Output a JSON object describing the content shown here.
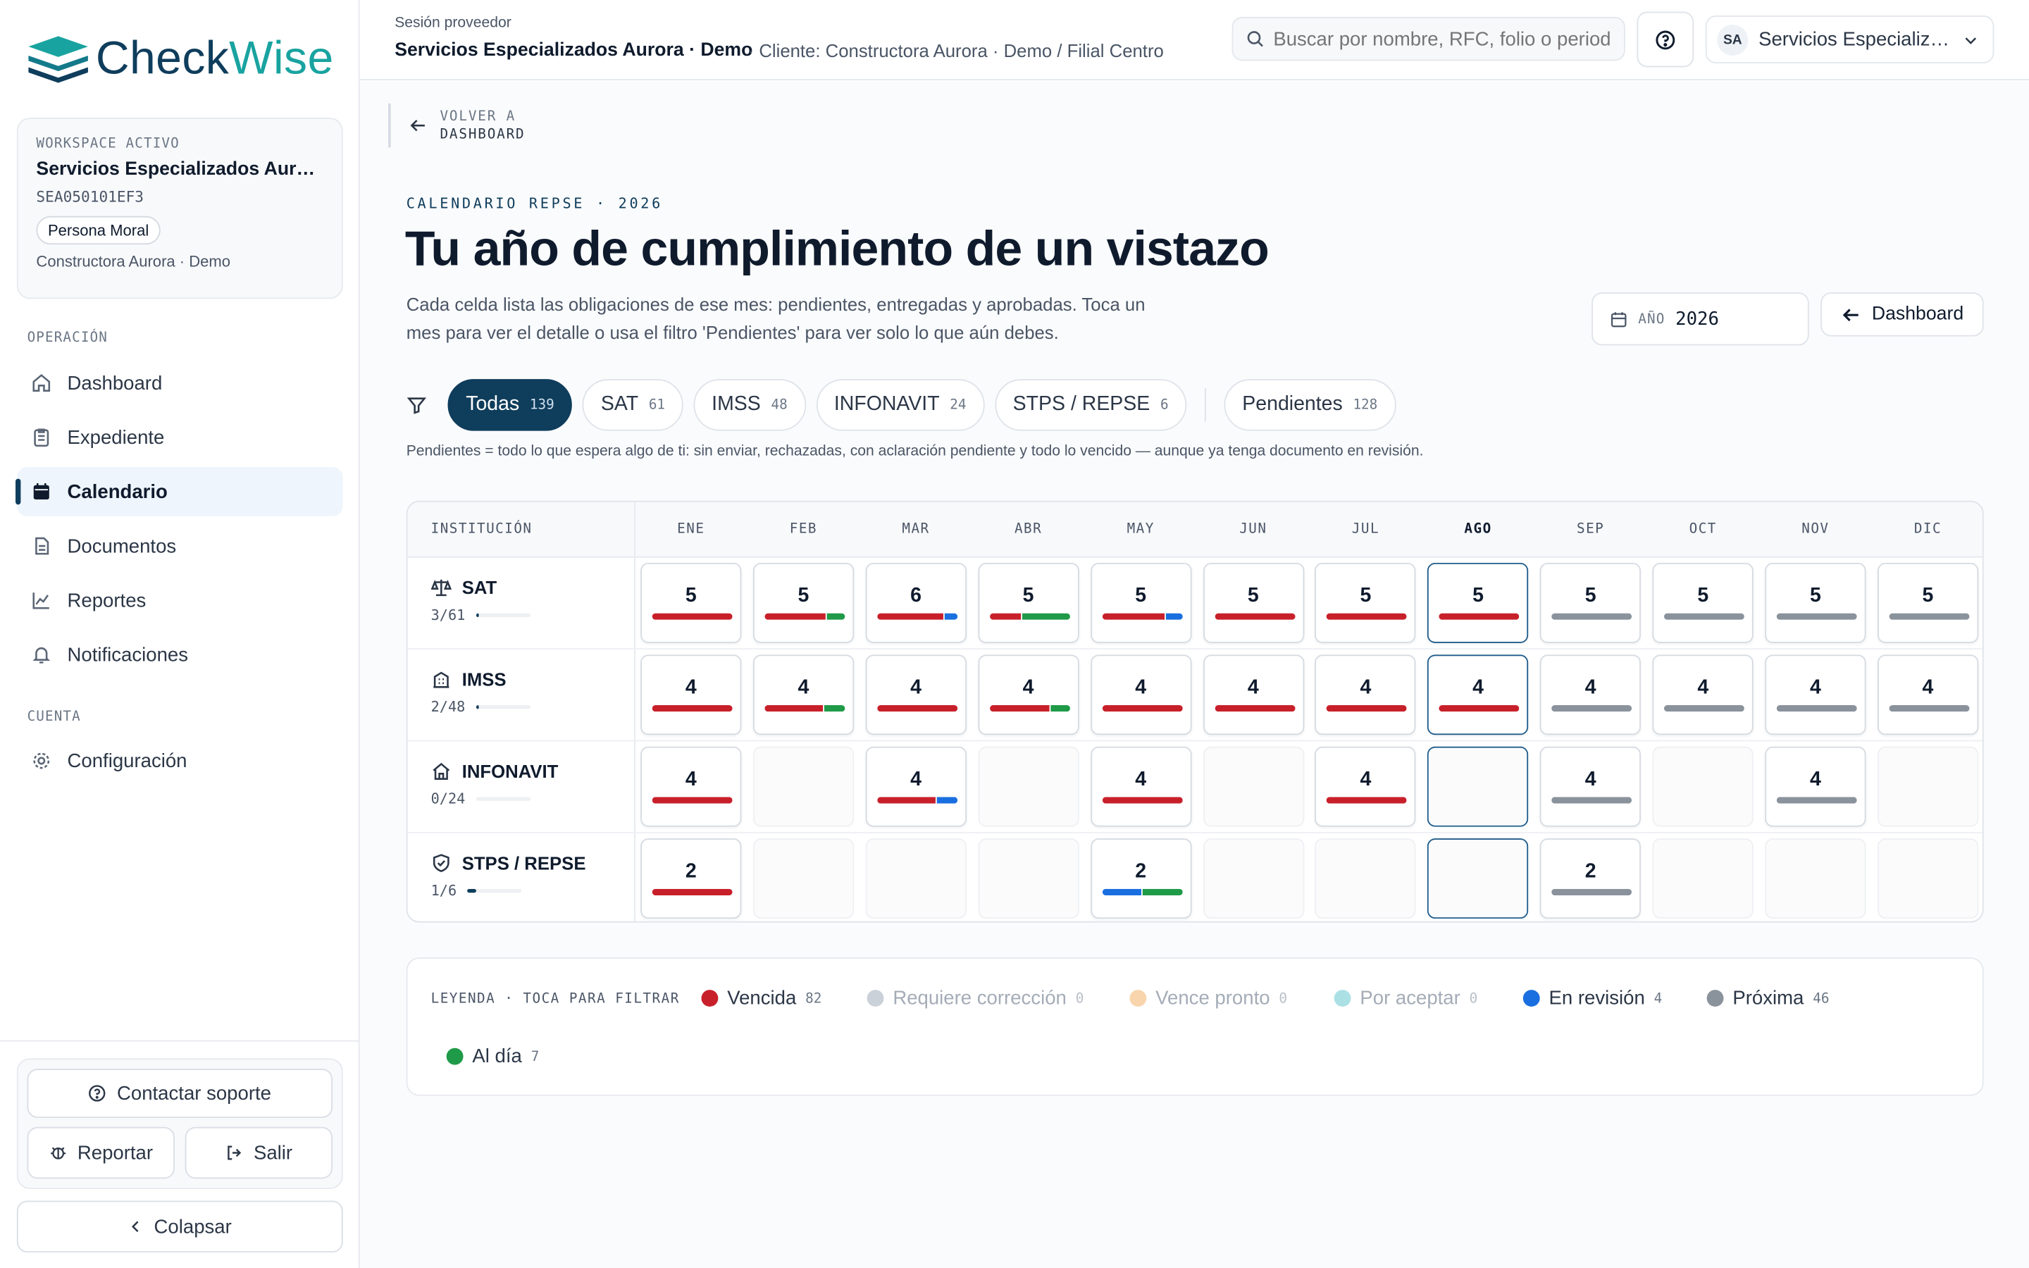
{
  "brand": {
    "name_part1": "Check",
    "name_part2": "Wise"
  },
  "workspace": {
    "label": "WORKSPACE ACTIVO",
    "name": "Servicios Especializados Aurora · Demo",
    "rfc": "SEA050101EF3",
    "type": "Persona Moral",
    "client": "Constructora Aurora · Demo"
  },
  "nav": {
    "section_operacion": "OPERACIÓN",
    "section_cuenta": "CUENTA",
    "items": [
      {
        "label": "Dashboard",
        "icon": "home-icon"
      },
      {
        "label": "Expediente",
        "icon": "clipboard-icon"
      },
      {
        "label": "Calendario",
        "icon": "calendar-icon",
        "active": true
      },
      {
        "label": "Documentos",
        "icon": "documents-icon"
      },
      {
        "label": "Reportes",
        "icon": "chart-icon"
      },
      {
        "label": "Notificaciones",
        "icon": "bell-icon"
      }
    ],
    "config_label": "Configuración"
  },
  "sidebar_footer": {
    "support": "Contactar soporte",
    "report": "Reportar",
    "logout": "Salir",
    "collapse": "Colapsar"
  },
  "topbar": {
    "session_label": "Sesión proveedor",
    "provider": "Servicios Especializados Aurora · Demo",
    "client_path": "· Cliente: Constructora Aurora · Demo / Filial Centro",
    "search_placeholder": "Buscar por nombre, RFC, folio o periodo",
    "account_initials": "SA",
    "account_name": "Servicios Especializados Aurora · Demo"
  },
  "back": {
    "line1": "VOLVER A",
    "line2": "DASHBOARD"
  },
  "header": {
    "eyebrow": "CALENDARIO REPSE · 2026",
    "title": "Tu año de cumplimiento de un vistazo",
    "description": "Cada celda lista las obligaciones de ese mes: pendientes, entregadas y aprobadas. Toca un mes para ver el detalle o usa el filtro 'Pendientes' para ver solo lo que aún debes.",
    "year_label": "AÑO",
    "year_value": "2026",
    "dashboard_button": "Dashboard"
  },
  "filters": [
    {
      "label": "Todas",
      "count": "139",
      "active": true
    },
    {
      "label": "SAT",
      "count": "61"
    },
    {
      "label": "IMSS",
      "count": "48"
    },
    {
      "label": "INFONAVIT",
      "count": "24"
    },
    {
      "label": "STPS / REPSE",
      "count": "6"
    },
    {
      "label": "Pendientes",
      "count": "128",
      "separated": true
    }
  ],
  "filter_note": "Pendientes = todo lo que espera algo de ti: sin enviar, rechazadas, con aclaración pendiente y todo lo vencido — aunque ya tenga documento en revisión.",
  "calendar": {
    "institution_header": "INSTITUCIÓN",
    "months": [
      "ENE",
      "FEB",
      "MAR",
      "ABR",
      "MAY",
      "JUN",
      "JUL",
      "AGO",
      "SEP",
      "OCT",
      "NOV",
      "DIC"
    ],
    "current_month_index": 7,
    "rows": [
      {
        "name": "SAT",
        "icon": "scale-icon",
        "progress_text": "3/61",
        "progress": 0.049,
        "cells": [
          {
            "count": "5",
            "segments": [
              [
                "red",
                1
              ]
            ]
          },
          {
            "count": "5",
            "segments": [
              [
                "red",
                0.78
              ],
              [
                "green",
                0.22
              ]
            ]
          },
          {
            "count": "6",
            "segments": [
              [
                "red",
                0.84
              ],
              [
                "blue",
                0.16
              ]
            ]
          },
          {
            "count": "5",
            "segments": [
              [
                "red",
                0.4
              ],
              [
                "green",
                0.6
              ]
            ]
          },
          {
            "count": "5",
            "segments": [
              [
                "red",
                0.8
              ],
              [
                "blue",
                0.2
              ]
            ]
          },
          {
            "count": "5",
            "segments": [
              [
                "red",
                1
              ]
            ]
          },
          {
            "count": "5",
            "segments": [
              [
                "red",
                1
              ]
            ]
          },
          {
            "count": "5",
            "segments": [
              [
                "red",
                1
              ]
            ]
          },
          {
            "count": "5",
            "segments": [
              [
                "gray",
                1
              ]
            ]
          },
          {
            "count": "5",
            "segments": [
              [
                "gray",
                1
              ]
            ]
          },
          {
            "count": "5",
            "segments": [
              [
                "gray",
                1
              ]
            ]
          },
          {
            "count": "5",
            "segments": [
              [
                "gray",
                1
              ]
            ]
          }
        ]
      },
      {
        "name": "IMSS",
        "icon": "building-icon",
        "progress_text": "2/48",
        "progress": 0.042,
        "cells": [
          {
            "count": "4",
            "segments": [
              [
                "red",
                1
              ]
            ]
          },
          {
            "count": "4",
            "segments": [
              [
                "red",
                0.74
              ],
              [
                "green",
                0.26
              ]
            ]
          },
          {
            "count": "4",
            "segments": [
              [
                "red",
                1
              ]
            ]
          },
          {
            "count": "4",
            "segments": [
              [
                "red",
                0.76
              ],
              [
                "green",
                0.24
              ]
            ]
          },
          {
            "count": "4",
            "segments": [
              [
                "red",
                1
              ]
            ]
          },
          {
            "count": "4",
            "segments": [
              [
                "red",
                1
              ]
            ]
          },
          {
            "count": "4",
            "segments": [
              [
                "red",
                1
              ]
            ]
          },
          {
            "count": "4",
            "segments": [
              [
                "red",
                1
              ]
            ]
          },
          {
            "count": "4",
            "segments": [
              [
                "gray",
                1
              ]
            ]
          },
          {
            "count": "4",
            "segments": [
              [
                "gray",
                1
              ]
            ]
          },
          {
            "count": "4",
            "segments": [
              [
                "gray",
                1
              ]
            ]
          },
          {
            "count": "4",
            "segments": [
              [
                "gray",
                1
              ]
            ]
          }
        ]
      },
      {
        "name": "INFONAVIT",
        "icon": "house-icon",
        "progress_text": "0/24",
        "progress": 0,
        "cells": [
          {
            "count": "4",
            "segments": [
              [
                "red",
                1
              ]
            ]
          },
          null,
          {
            "count": "4",
            "segments": [
              [
                "red",
                0.74
              ],
              [
                "blue",
                0.26
              ]
            ]
          },
          null,
          {
            "count": "4",
            "segments": [
              [
                "red",
                1
              ]
            ]
          },
          null,
          {
            "count": "4",
            "segments": [
              [
                "red",
                1
              ]
            ]
          },
          null,
          {
            "count": "4",
            "segments": [
              [
                "gray",
                1
              ]
            ]
          },
          null,
          {
            "count": "4",
            "segments": [
              [
                "gray",
                1
              ]
            ]
          },
          null
        ]
      },
      {
        "name": "STPS / REPSE",
        "icon": "shield-check-icon",
        "progress_text": "1/6",
        "progress": 0.167,
        "cells": [
          {
            "count": "2",
            "segments": [
              [
                "red",
                1
              ]
            ]
          },
          null,
          null,
          null,
          {
            "count": "2",
            "segments": [
              [
                "blue",
                0.5
              ],
              [
                "green",
                0.5
              ]
            ]
          },
          null,
          null,
          null,
          {
            "count": "2",
            "segments": [
              [
                "gray",
                1
              ]
            ]
          },
          null,
          null,
          null
        ]
      }
    ]
  },
  "legend": {
    "title": "LEYENDA · TOCA PARA FILTRAR",
    "items": [
      {
        "label": "Vencida",
        "count": "82",
        "color": "#c8202a",
        "dim": false
      },
      {
        "label": "Requiere corrección",
        "count": "0",
        "color": "#b9c2cc",
        "dim": true
      },
      {
        "label": "Vence pronto",
        "count": "0",
        "color": "#f6c792",
        "dim": true
      },
      {
        "label": "Por aceptar",
        "count": "0",
        "color": "#8fd6dc",
        "dim": true
      },
      {
        "label": "En revisión",
        "count": "4",
        "color": "#1a6fe0",
        "dim": false
      },
      {
        "label": "Próxima",
        "count": "46",
        "color": "#8a929c",
        "dim": false
      },
      {
        "label": "Al día",
        "count": "7",
        "color": "#1f9a48",
        "dim": false
      }
    ]
  },
  "colors": {
    "red": "#c8202a",
    "green": "#1f9a48",
    "blue": "#1a6fe0",
    "gray": "#8a929c",
    "brand": "#0f3d5c",
    "accent": "#19a3a0"
  }
}
